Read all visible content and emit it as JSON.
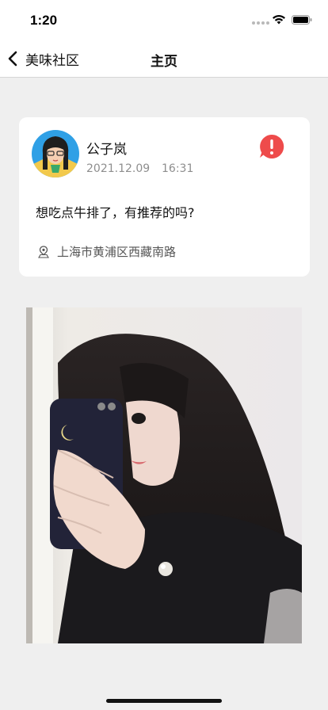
{
  "status_bar": {
    "time": "1:20"
  },
  "nav": {
    "back_label": "美味社区",
    "title": "主页"
  },
  "post": {
    "author": "公子岚",
    "date": "2021.12.09",
    "time": "16:31",
    "text": "想吃点牛排了，有推荐的吗?",
    "location": "上海市黄浦区西藏南路"
  },
  "colors": {
    "report_red": "#ee4b4b",
    "accent_gray": "#8e8e8e"
  },
  "icons": [
    "back-icon",
    "wifi-icon",
    "battery-icon",
    "report-icon",
    "location-pin-icon"
  ]
}
